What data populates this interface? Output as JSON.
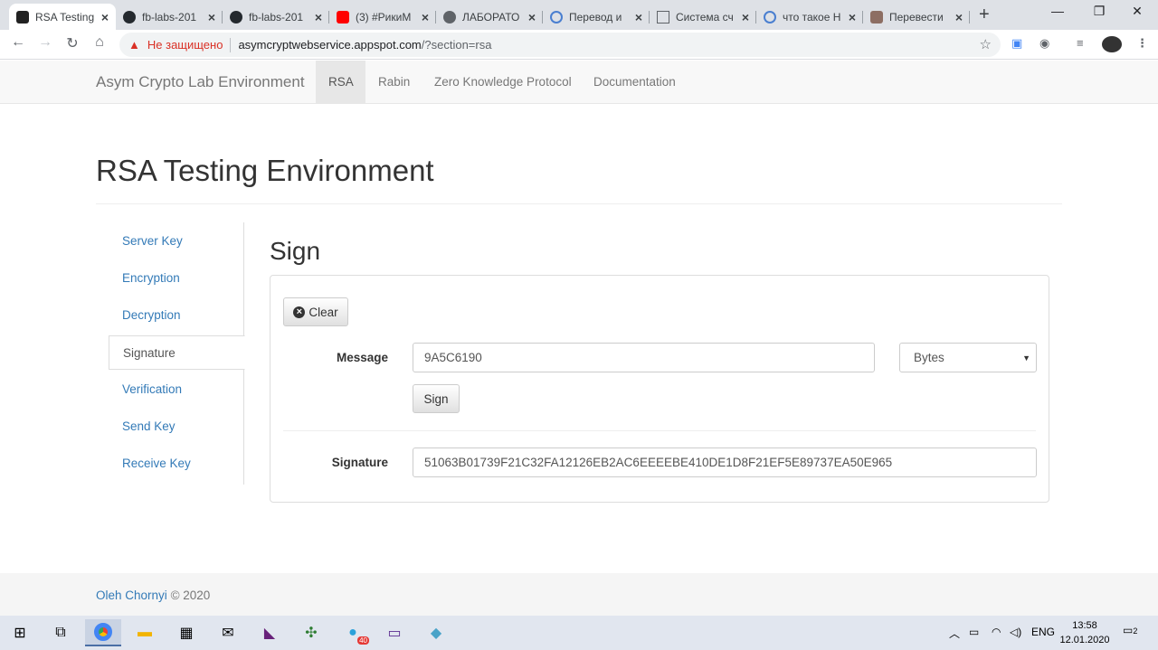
{
  "browser": {
    "tabs": [
      {
        "title": "RSA Testing",
        "icon": "site-icon",
        "active": true
      },
      {
        "title": "fb-labs-201",
        "icon": "github-icon"
      },
      {
        "title": "fb-labs-201",
        "icon": "github-icon"
      },
      {
        "title": "(3) #РикиМ",
        "icon": "youtube-icon"
      },
      {
        "title": "ЛАБОРАТО",
        "icon": "globe-icon"
      },
      {
        "title": "Перевод и",
        "icon": "network-icon"
      },
      {
        "title": "Система сч",
        "icon": "page-icon"
      },
      {
        "title": "что такое Н",
        "icon": "network-icon"
      },
      {
        "title": "Перевести",
        "icon": "translate-icon"
      }
    ],
    "new_tab": "+",
    "window_controls": [
      "—",
      "❐",
      "✕"
    ],
    "nav": {
      "back": "←",
      "forward": "→",
      "reload": "↻",
      "home": "⌂"
    },
    "security_warning": "Не защищено",
    "url_host": "asymcryptwebservice.appspot.com",
    "url_path": "/?section=rsa",
    "bookmark_star": "☆"
  },
  "navbar": {
    "brand": "Asym Crypto Lab Environment",
    "links": [
      "RSA",
      "Rabin",
      "Zero Knowledge Protocol",
      "Documentation"
    ],
    "active": "RSA"
  },
  "page": {
    "title": "RSA Testing Environment",
    "sidebar": [
      "Server Key",
      "Encryption",
      "Decryption",
      "Signature",
      "Verification",
      "Send Key",
      "Receive Key"
    ],
    "sidebar_active": "Signature",
    "section_title": "Sign",
    "clear_button": "Clear",
    "message_label": "Message",
    "message_value": "9A5C6190",
    "format_select": "Bytes",
    "sign_button": "Sign",
    "signature_label": "Signature",
    "signature_value": "51063B01739F21C32FA12126EB2AC6EEEEBE410DE1D8F21EF5E89737EA50E965"
  },
  "footer": {
    "author": "Oleh Chornyi",
    "suffix": "© 2020"
  },
  "taskbar": {
    "lang": "ENG",
    "time": "13:58",
    "date": "12.01.2020",
    "notification_count": "2",
    "badge": "40"
  }
}
